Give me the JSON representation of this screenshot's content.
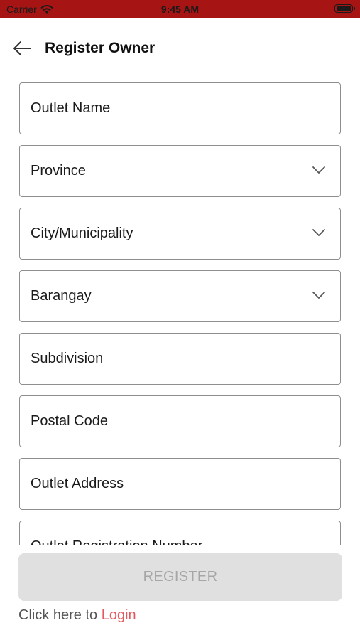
{
  "status_bar": {
    "carrier": "Carrier",
    "time": "9:45 AM",
    "background": "#a71414"
  },
  "header": {
    "title": "Register Owner",
    "back_icon": "arrow-left-icon"
  },
  "form": {
    "fields": [
      {
        "label": "Outlet Name",
        "type": "text"
      },
      {
        "label": "Province",
        "type": "select"
      },
      {
        "label": "City/Municipality",
        "type": "select"
      },
      {
        "label": "Barangay",
        "type": "select"
      },
      {
        "label": "Subdivision",
        "type": "text"
      },
      {
        "label": "Postal Code",
        "type": "text"
      },
      {
        "label": "Outlet Address",
        "type": "text"
      },
      {
        "label": "Outlet Registration Number",
        "type": "text"
      }
    ]
  },
  "register_button": {
    "label": "REGISTER",
    "disabled": true
  },
  "login_prompt": {
    "text": "Click here to ",
    "link": "Login",
    "link_color": "#e25a5f"
  }
}
